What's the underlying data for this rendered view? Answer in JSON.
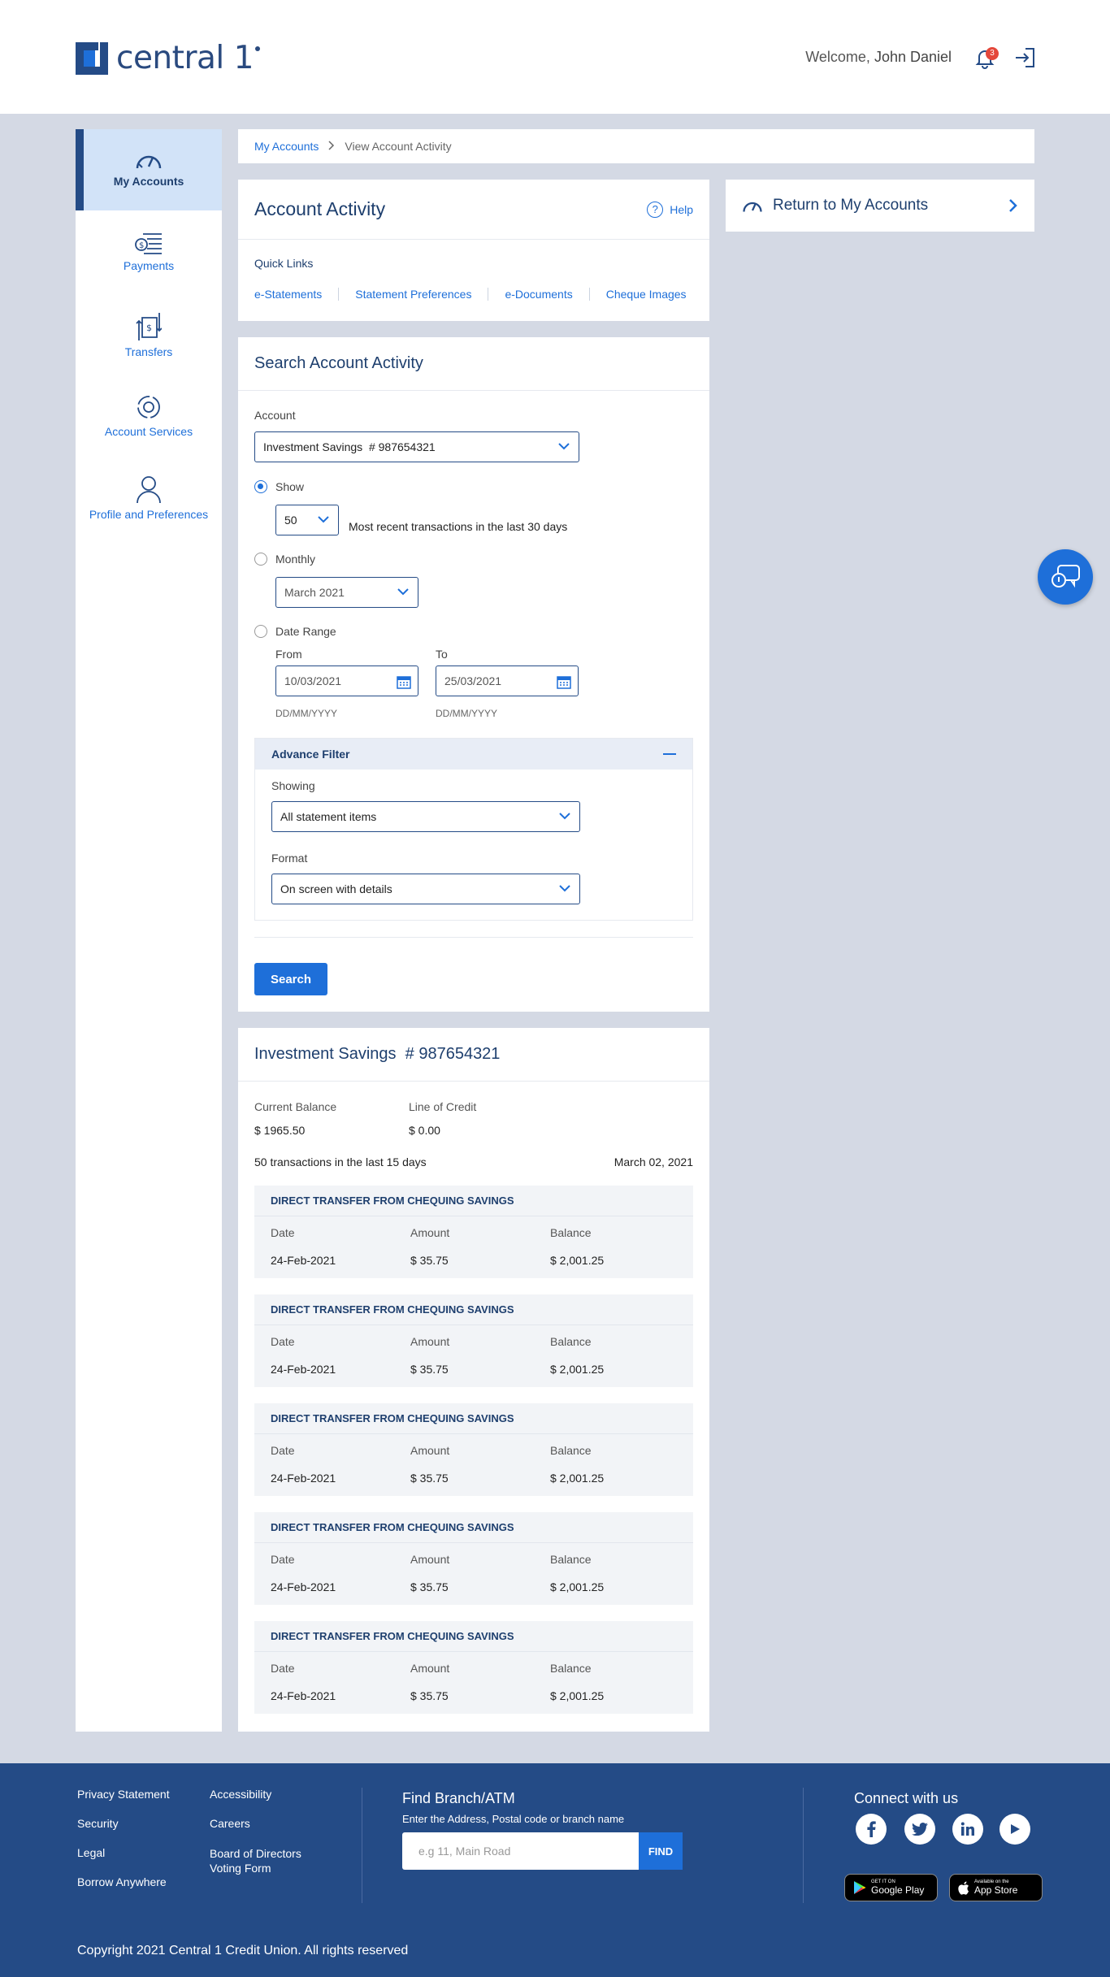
{
  "brand": {
    "name": "central 1"
  },
  "header": {
    "welcome_prefix": "Welcome, ",
    "user_name": "John Daniel",
    "notification_count": "3"
  },
  "sidebar": {
    "items": [
      {
        "label": "My Accounts"
      },
      {
        "label": "Payments"
      },
      {
        "label": "Transfers"
      },
      {
        "label": "Account Services"
      },
      {
        "label": "Profile and Preferences"
      }
    ]
  },
  "breadcrumb": {
    "root": "My Accounts",
    "separator": ">",
    "current": "View Account Activity"
  },
  "activity": {
    "title": "Account Activity",
    "help": "Help",
    "quick_links_title": "Quick Links",
    "quick_links": [
      "e-Statements",
      "Statement Preferences",
      "e-Documents",
      "Cheque Images"
    ]
  },
  "return_card": {
    "label": "Return to My Accounts"
  },
  "search": {
    "title": "Search Account Activity",
    "account_label": "Account",
    "account_value": "Investment Savings  # 987654321",
    "show_label": "Show",
    "show_value": "50",
    "show_desc": "Most recent transactions in the last 30 days",
    "monthly_label": "Monthly",
    "monthly_value": "March 2021",
    "range_label": "Date Range",
    "from_label": "From",
    "from_value": "10/03/2021",
    "to_label": "To",
    "to_value": "25/03/2021",
    "date_hint": "DD/MM/YYYY",
    "advance_title": "Advance Filter",
    "showing_label": "Showing",
    "showing_value": "All statement items",
    "format_label": "Format",
    "format_value": "On screen with details",
    "button": "Search"
  },
  "savings": {
    "title": "Investment Savings  # 987654321",
    "current_balance_label": "Current Balance",
    "current_balance": "$ 1965.50",
    "credit_label": "Line of Credit",
    "credit": "$ 0.00",
    "summary": "50 transactions in the last 15 days",
    "date": "March 02, 2021",
    "col_date": "Date",
    "col_amount": "Amount",
    "col_balance": "Balance",
    "transactions": [
      {
        "title": "DIRECT TRANSFER FROM CHEQUING SAVINGS",
        "date": "24-Feb-2021",
        "amount": "$ 35.75",
        "balance": "$ 2,001.25"
      },
      {
        "title": "DIRECT TRANSFER FROM CHEQUING SAVINGS",
        "date": "24-Feb-2021",
        "amount": "$ 35.75",
        "balance": "$ 2,001.25"
      },
      {
        "title": "DIRECT TRANSFER FROM CHEQUING SAVINGS",
        "date": "24-Feb-2021",
        "amount": "$ 35.75",
        "balance": "$ 2,001.25"
      },
      {
        "title": "DIRECT TRANSFER FROM CHEQUING SAVINGS",
        "date": "24-Feb-2021",
        "amount": "$ 35.75",
        "balance": "$ 2,001.25"
      },
      {
        "title": "DIRECT TRANSFER FROM CHEQUING SAVINGS",
        "date": "24-Feb-2021",
        "amount": "$ 35.75",
        "balance": "$ 2,001.25"
      }
    ]
  },
  "footer": {
    "links_col1": [
      "Privacy Statement",
      "Security",
      "Legal",
      "Borrow Anywhere"
    ],
    "links_col2": [
      "Accessibility",
      "Careers",
      "Board of Directors Voting Form"
    ],
    "find_title": "Find Branch/ATM",
    "find_sub": "Enter the Address, Postal code or branch name",
    "find_placeholder": "e.g 11, Main Road",
    "find_button": "FIND",
    "connect": "Connect with us",
    "google_small": "GET IT ON",
    "google_big": "Google Play",
    "apple_small": "Available on the",
    "apple_big": "App Store",
    "copyright": "Copyright 2021 Central 1 Credit Union. All rights reserved"
  },
  "colors": {
    "primary": "#1e6fd9",
    "navy": "#244b86",
    "page_bg": "#d4d9e4"
  }
}
